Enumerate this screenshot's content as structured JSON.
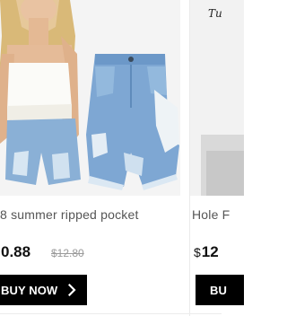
{
  "products": [
    {
      "title": "8 summer ripped pocket",
      "currency": "",
      "price": "0.88",
      "old_price": "$12.80",
      "button_label": "BUY NOW",
      "image_icon": "product-photo-denim-shorts"
    },
    {
      "title": "Hole F",
      "currency": "$",
      "price": "12",
      "button_label": "BU",
      "watermark": "Tu",
      "image_icon": "product-photo"
    }
  ],
  "colors": {
    "button_bg": "#000000",
    "button_text": "#ffffff",
    "old_price": "#9a9a9a",
    "title": "#555555"
  }
}
